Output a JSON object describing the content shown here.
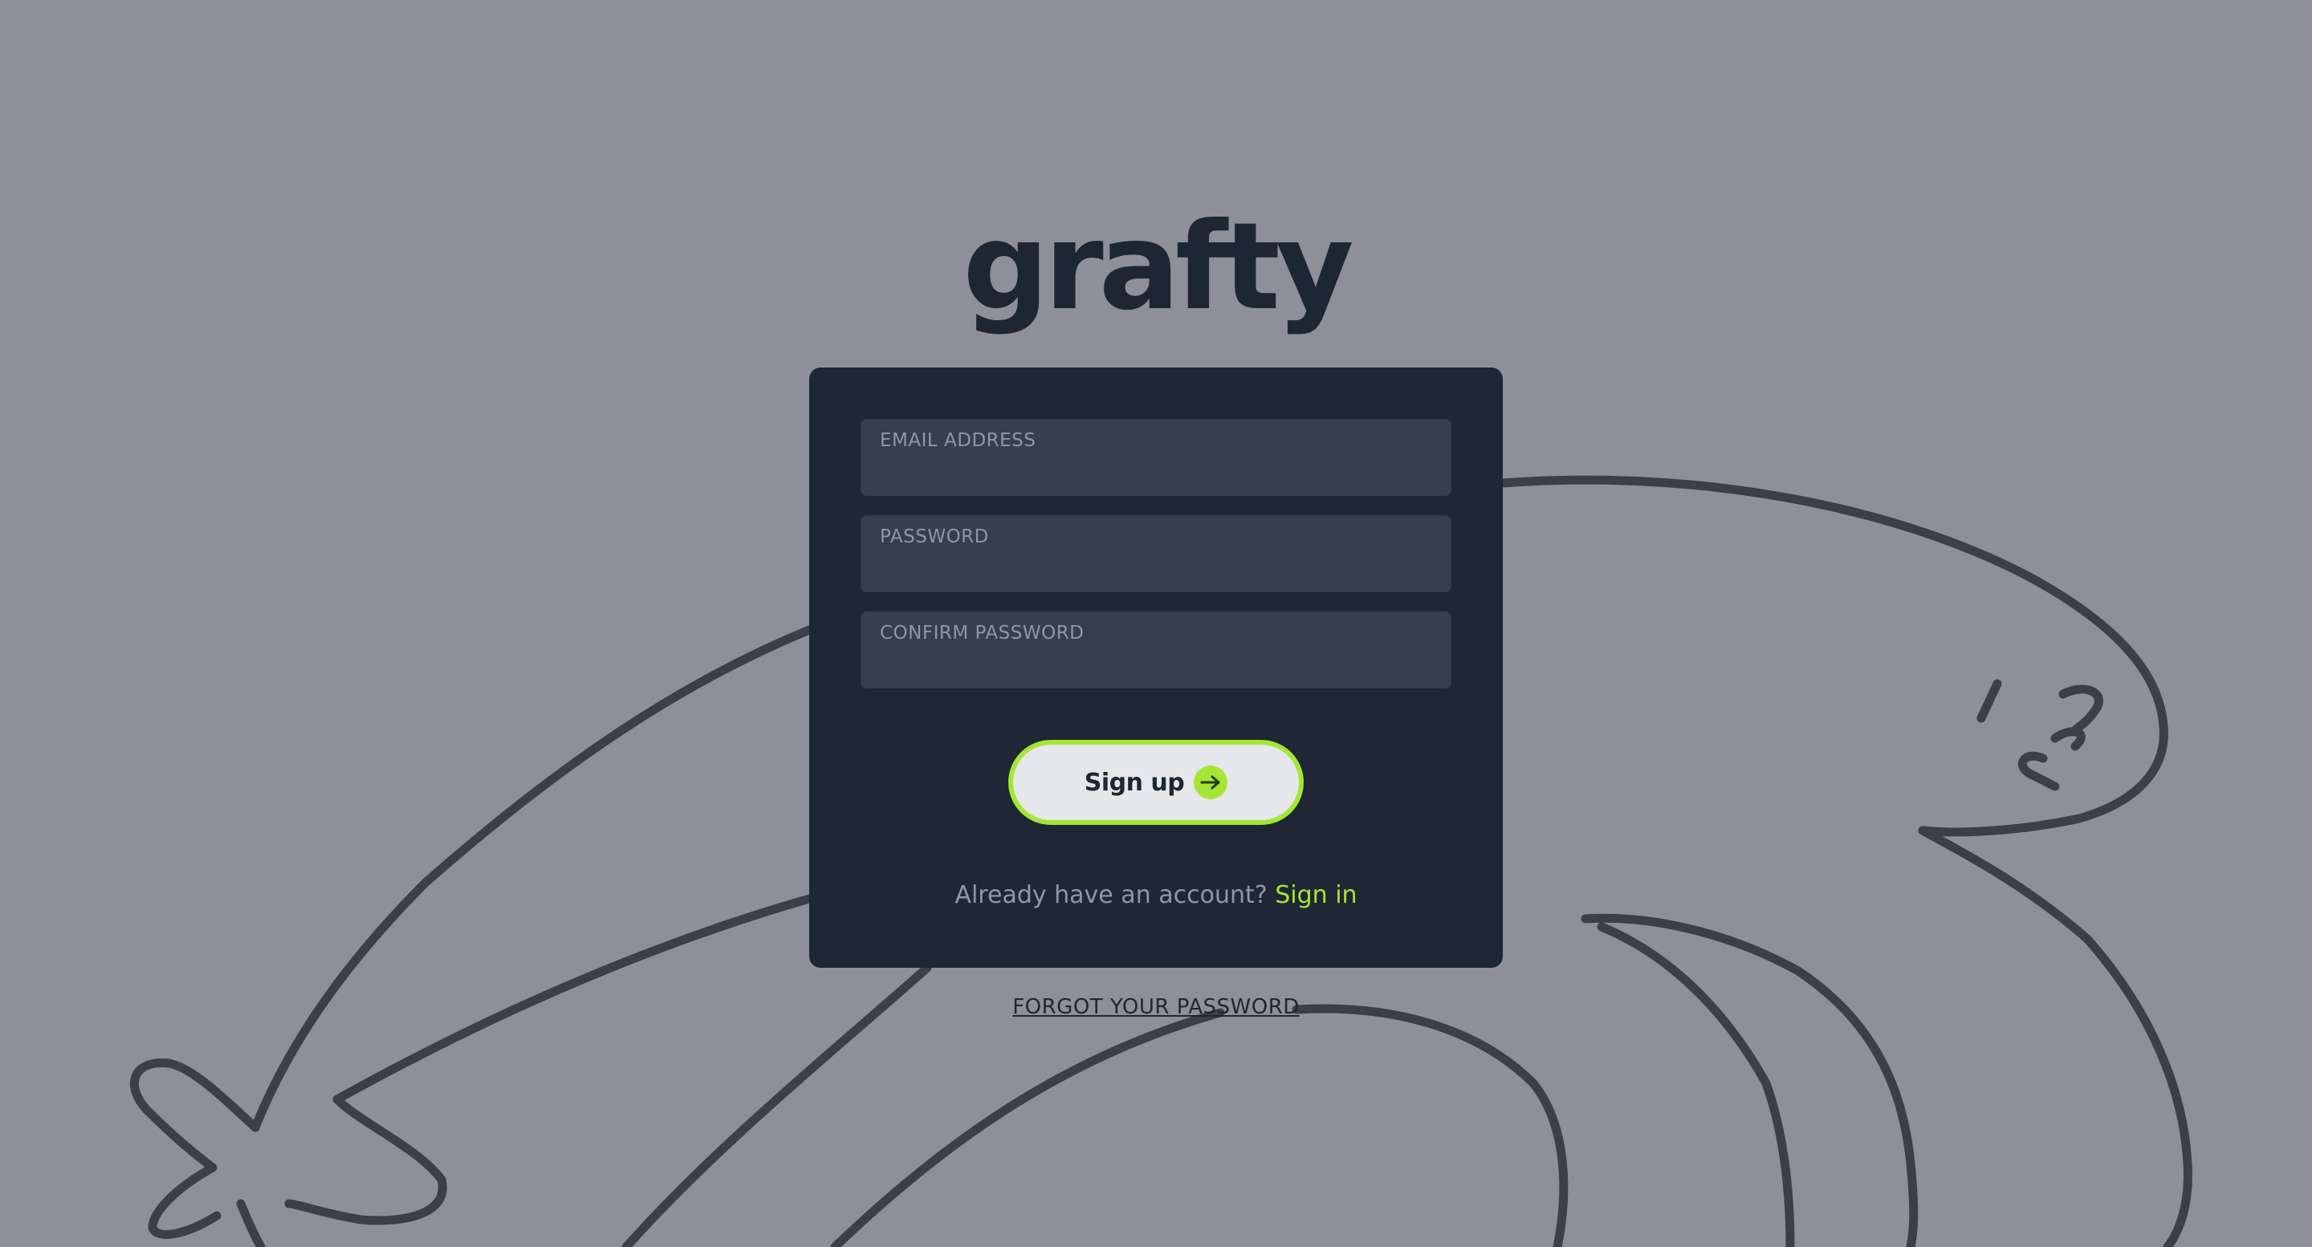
{
  "brand": {
    "logo_text": "grafty"
  },
  "form": {
    "email": {
      "label": "EMAIL ADDRESS",
      "value": ""
    },
    "password": {
      "label": "PASSWORD",
      "value": ""
    },
    "confirm_password": {
      "label": "CONFIRM PASSWORD",
      "value": ""
    },
    "submit_label": "Sign up",
    "signin_prompt": "Already have an account?",
    "signin_link": "Sign in"
  },
  "footer": {
    "forgot_password": "FORGOT YOUR PASSWORD"
  },
  "colors": {
    "background": "#8d9098",
    "card": "#1f2635",
    "field": "#363e4f",
    "accent": "#a3e635",
    "doodle_stroke": "#3b3f47"
  },
  "icons": {
    "submit": "arrow-right-circle-icon"
  }
}
